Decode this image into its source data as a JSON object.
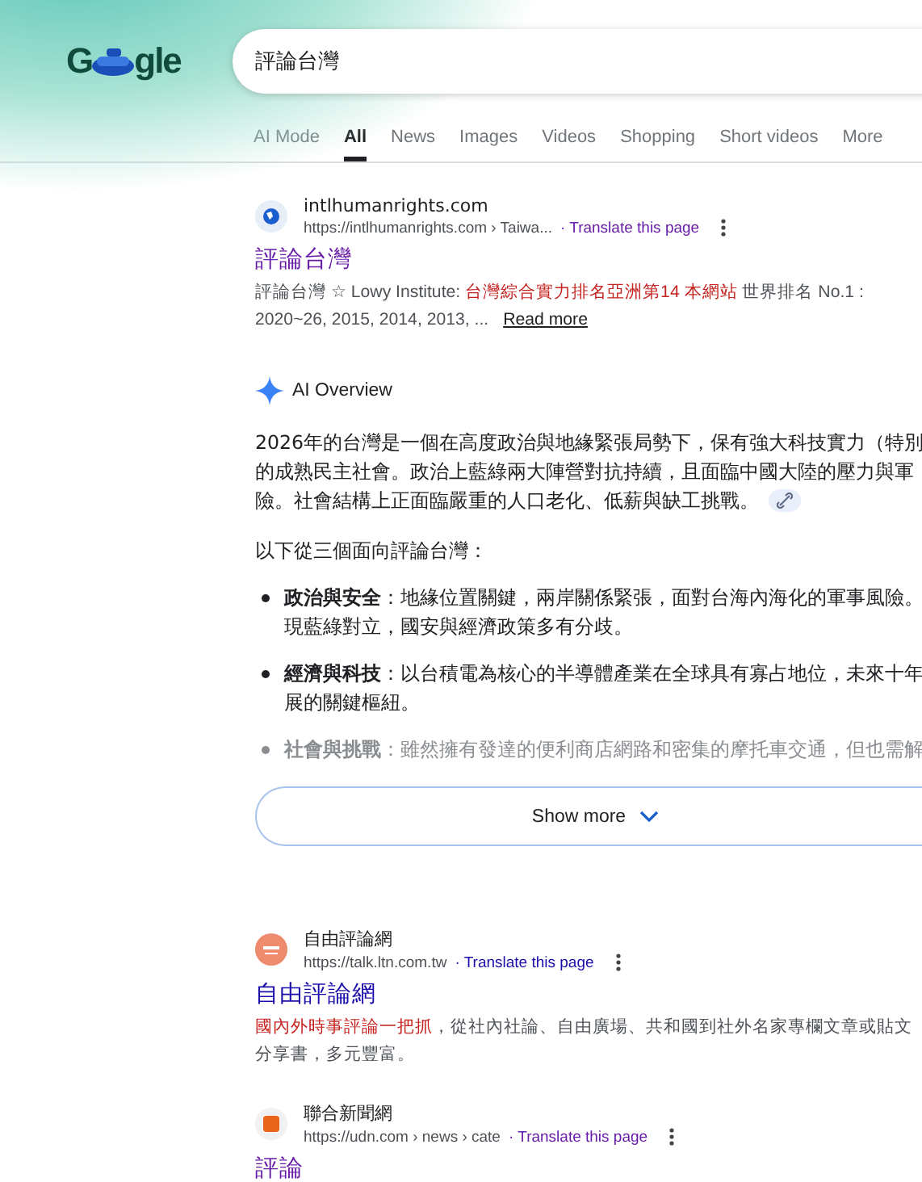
{
  "logo": {
    "left": "G",
    "right": "gle"
  },
  "search": {
    "value": "評論台灣"
  },
  "tabs": [
    {
      "label": "AI Mode",
      "selected": false
    },
    {
      "label": "All",
      "selected": true
    },
    {
      "label": "News",
      "selected": false
    },
    {
      "label": "Images",
      "selected": false
    },
    {
      "label": "Videos",
      "selected": false
    },
    {
      "label": "Shopping",
      "selected": false
    },
    {
      "label": "Short videos",
      "selected": false
    },
    {
      "label": "More",
      "selected": false
    }
  ],
  "results_top": [
    {
      "site": "intlhumanrights.com",
      "url": "https://intlhumanrights.com › Taiwa...",
      "translate": "· Translate this page",
      "title": "評論台灣",
      "visited": true,
      "color": "#1a5fd0",
      "snippet": [
        {
          "text": "評論台灣 ☆ Lowy Institute: ",
          "highlight": false
        },
        {
          "text": "台灣綜合實力排名亞洲第14 本網站",
          "highlight": true
        },
        {
          "text": " 世界排名 No.1 : 2020~26, 2015, 2014, 2013, ... ",
          "highlight": false
        }
      ],
      "more": "Read more"
    }
  ],
  "ai_overview": {
    "heading": "AI Overview",
    "paragraph": [
      "2026年的台灣是一個在高度政治與地緣緊張局勢下，保有強大科技實力（特別",
      "的成熟民主社會。政治上藍綠兩大陣營對抗持續，且面臨中國大陸的壓力與軍",
      "險。社會結構上正面臨嚴重的人口老化、低薪與缺工挑戰。"
    ],
    "intro": "以下從三個面向評論台灣：",
    "bullets": [
      {
        "lines": [
          "**政治與安全**：地緣位置關鍵，兩岸關係緊張，面對台海內海化的軍事風險。",
          "現藍綠對立，國安與經濟政策多有分歧。"
        ],
        "faded": false
      },
      {
        "lines": [
          "**經濟與科技**：以台積電為核心的半導體產業在全球具有寡占地位，未來十年",
          "展的關鍵樞紐。"
        ],
        "faded": false
      },
      {
        "lines": [
          "**社會與挑戰**：雖然擁有發達的便利商店網路和密集的摩托車交通，但也需解"
        ],
        "faded": true
      }
    ],
    "show_more": "Show more"
  },
  "results": [
    {
      "site": "自由評論網",
      "url": "https://talk.ltn.com.tw",
      "translate": "· Translate this page",
      "title": "自由評論網",
      "visited": false,
      "color": "#ee8a6e",
      "snippet": [
        {
          "text": "國內外時事評論一把抓",
          "highlight": true
        },
        {
          "text": "，從社內社論、自由廣場、共和國到社外名家專欄文章或貼文分享書，多元豐富。",
          "highlight": false
        }
      ]
    },
    {
      "site": "聯合新聞網",
      "url": "https://udn.com › news › cate",
      "translate": "· Translate this page",
      "title": "評論",
      "visited": true,
      "color": "#e8651a"
    }
  ]
}
